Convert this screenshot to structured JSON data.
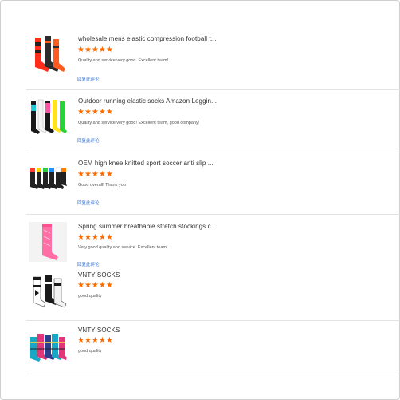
{
  "reviews": [
    {
      "title": "wholesale mens elastic compression football t...",
      "stars": "★★★★★",
      "comment": "Quality and service very good. Excellent team!",
      "reply": "回复此评论",
      "colors": [
        "#ff2d1a",
        "#2b2b2b",
        "#ff5a1f"
      ]
    },
    {
      "title": "Outdoor running elastic socks Amazon Leggin...",
      "stars": "★★★★★",
      "comment": "Quality and service very good! Excellent team, good company!",
      "reply": "回复此评论",
      "colors": [
        "#22c7d6",
        "#ffffff",
        "#ff55a8",
        "#ffe320",
        "#2bd13a"
      ]
    },
    {
      "title": "OEM high knee knitted sport soccer anti slip ...",
      "stars": "★★★★★",
      "comment": "Good overall! Thank you",
      "reply": "回复此评论",
      "colors": [
        "#ff3b30",
        "#ffcc00",
        "#2ecc40",
        "#1e90ff",
        "#ffffff",
        "#ff7f00"
      ]
    },
    {
      "title": "Spring summer breathable stretch stockings c...",
      "stars": "★★★★★",
      "comment": "Very good quality and service. Excellent team!",
      "reply": "回复此评论",
      "colors": [
        "#ff6fa5"
      ]
    },
    {
      "title": "VNTY SOCKS",
      "stars": "★★★★★",
      "comment": "good quality",
      "reply": "",
      "colors": [
        "#ffffff",
        "#1a1a1a"
      ]
    },
    {
      "title": "VNTY SOCKS",
      "stars": "★★★★★",
      "comment": "good quality",
      "reply": "",
      "colors": [
        "#19a7c8",
        "#e0367a",
        "#2c3e8c"
      ]
    }
  ]
}
